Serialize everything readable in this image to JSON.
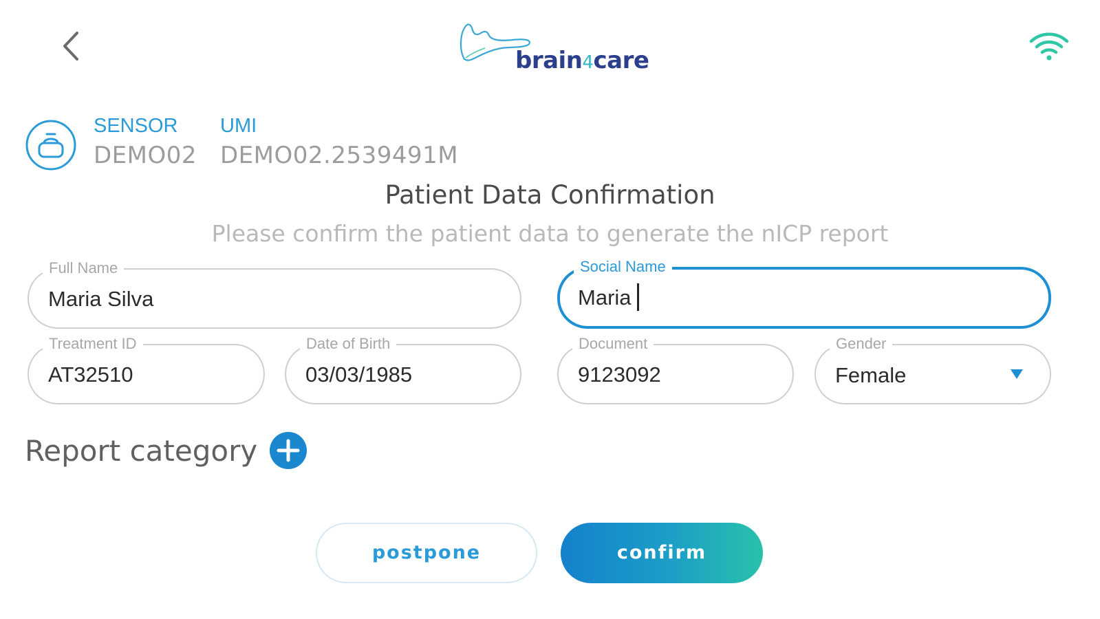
{
  "header": {
    "back_icon": "chevron-left-icon",
    "logo_text_a": "brain",
    "logo_text_four": "4",
    "logo_text_b": "care",
    "wifi_icon": "wifi-icon",
    "wifi_color": "#2fc7a6"
  },
  "sensor": {
    "icon": "sensor-device-icon",
    "sensor_label": "SENSOR",
    "sensor_value": "DEMO02",
    "umi_label": "UMI",
    "umi_value": "DEMO02.2539491M"
  },
  "page": {
    "title": "Patient Data Confirmation",
    "subtitle": "Please confirm the patient data to generate the nICP report"
  },
  "form": {
    "full_name": {
      "label": "Full Name",
      "value": "Maria Silva"
    },
    "social_name": {
      "label": "Social Name",
      "value": "Maria",
      "focused": true
    },
    "treatment_id": {
      "label": "Treatment ID",
      "value": "AT32510"
    },
    "date_of_birth": {
      "label": "Date of Birth",
      "value": "03/03/1985"
    },
    "document": {
      "label": "Document",
      "value": "9123092"
    },
    "gender": {
      "label": "Gender",
      "value": "Female",
      "arrow_icon": "triangle-down-icon"
    }
  },
  "report_category": {
    "label": "Report category",
    "add_icon": "plus-circle-icon"
  },
  "actions": {
    "postpone_label": "postpone",
    "confirm_label": "confirm"
  },
  "colors": {
    "accent": "#1f8fd3",
    "brand_navy": "#2b3f8c",
    "brand_teal": "#35b8c8",
    "confirm_gradient_start": "#1581cc",
    "confirm_gradient_end": "#29c1aa"
  }
}
